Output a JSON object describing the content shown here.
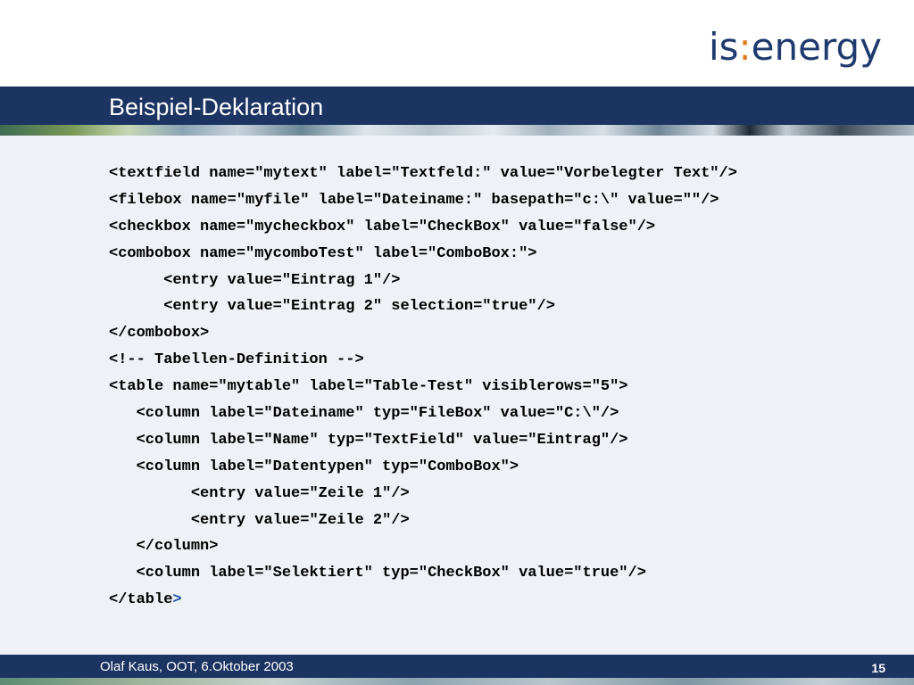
{
  "logo": {
    "part1": "is",
    "colon": ":",
    "part2": "energy"
  },
  "slide": {
    "title": "Beispiel-Deklaration"
  },
  "code_lines": [
    {
      "indent": "",
      "text": "<textfield name=\"mytext\" label=\"Textfeld:\" value=\"Vorbelegter Text\"/>"
    },
    {
      "indent": "",
      "text": "<filebox name=\"myfile\" label=\"Dateiname:\" basepath=\"c:\\\" value=\"\"/>"
    },
    {
      "indent": "",
      "text": "<checkbox name=\"mycheckbox\" label=\"CheckBox\" value=\"false\"/>"
    },
    {
      "indent": "",
      "text": "<combobox name=\"mycomboTest\" label=\"ComboBox:\">"
    },
    {
      "indent": "      ",
      "text": "<entry value=\"Eintrag 1\"/>"
    },
    {
      "indent": "      ",
      "text": "<entry value=\"Eintrag 2\" selection=\"true\"/>"
    },
    {
      "indent": "",
      "text": "</combobox>"
    },
    {
      "indent": "",
      "text": "<!-- Tabellen-Definition -->"
    },
    {
      "indent": "",
      "text": "<table name=\"mytable\" label=\"Table-Test\" visiblerows=\"5\">"
    },
    {
      "indent": "   ",
      "text": "<column label=\"Dateiname\" typ=\"FileBox\" value=\"C:\\\"/>"
    },
    {
      "indent": "   ",
      "text": "<column label=\"Name\" typ=\"TextField\" value=\"Eintrag\"/>"
    },
    {
      "indent": "   ",
      "text": "<column label=\"Datentypen\" typ=\"ComboBox\">"
    },
    {
      "indent": "         ",
      "text": "<entry value=\"Zeile 1\"/>"
    },
    {
      "indent": "         ",
      "text": "<entry value=\"Zeile 2\"/>"
    },
    {
      "indent": "   ",
      "text": "</column>"
    },
    {
      "indent": "   ",
      "text": "<column label=\"Selektiert\" typ=\"CheckBox\" value=\"true\"/>"
    },
    {
      "indent": "",
      "text": "</table",
      "tail": ">"
    }
  ],
  "footer": {
    "text": "Olaf Kaus, OOT, 6.Oktober 2003",
    "page_number": "15"
  },
  "colors": {
    "brand_navy": "#1c3461",
    "logo_text": "#1e3a6e",
    "logo_colon": "#e07b1a",
    "content_background": "#eef1f5"
  }
}
